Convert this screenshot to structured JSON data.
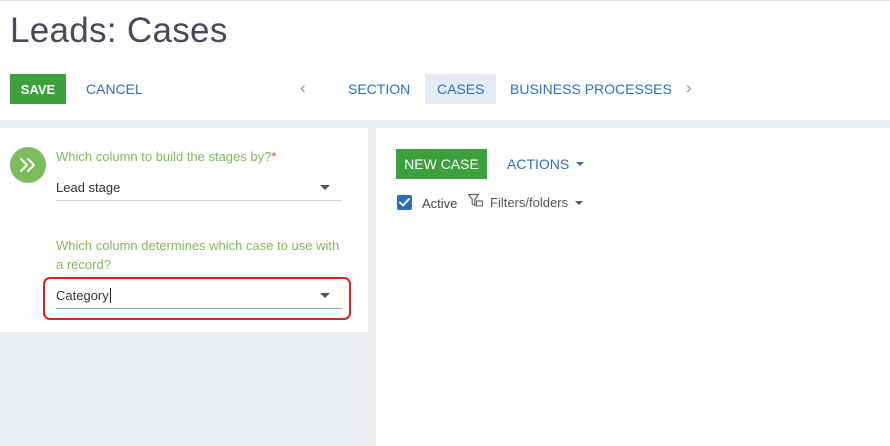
{
  "page": {
    "title": "Leads: Cases"
  },
  "toolbar": {
    "save_label": "SAVE",
    "cancel_label": "CANCEL"
  },
  "tabs": [
    {
      "label": "SECTION",
      "active": false
    },
    {
      "label": "CASES",
      "active": true
    },
    {
      "label": "BUSINESS PROCESSES",
      "active": false
    }
  ],
  "nav": {
    "prev_glyph": "‹",
    "next_glyph": "›"
  },
  "settings": {
    "icon": "double-chevron-right-icon",
    "stage_question": "Which column to build the stages by?",
    "required_mark": "*",
    "stage_value": "Lead stage",
    "case_question": "Which column determines which case to use with a record?",
    "case_value": "Category"
  },
  "cases_panel": {
    "new_case_label": "NEW CASE",
    "actions_label": "ACTIONS",
    "active_label": "Active",
    "active_checked": true,
    "filters_label": "Filters/folders"
  },
  "colors": {
    "accent_green": "#3ca03c",
    "link_blue": "#2e70b8",
    "label_green": "#7dbc5a",
    "highlight_red": "#e02020"
  }
}
